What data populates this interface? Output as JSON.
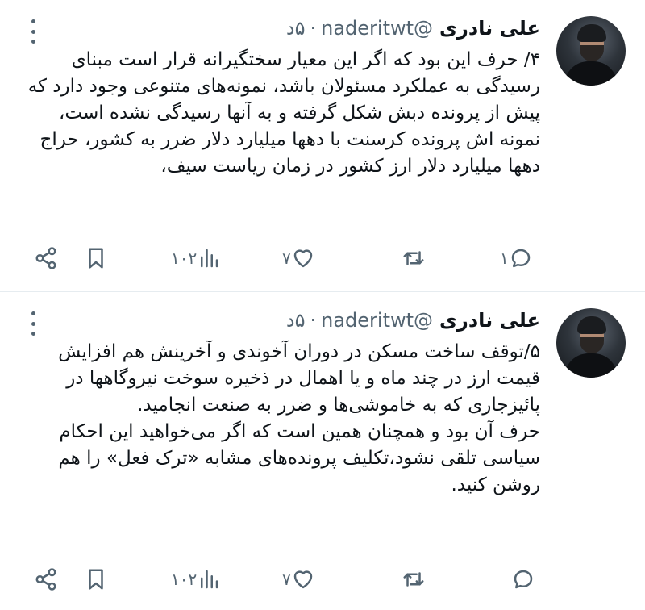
{
  "tweets": [
    {
      "name": "علی نادری",
      "handle": "@naderitwt",
      "separator": "·",
      "time": "۵د",
      "text": "۴/ حرف این بود که اگر این معیار سختگیرانه قرار است مبنای رسیدگی به عملکرد مسئولان باشد، نمونه‌های متنوعی وجود دارد که پیش از پرونده دبش شکل گرفته و به آنها رسیدگی نشده است، نمونه اش پرونده کرسنت با دهها میلیارد دلار ضرر به کشور، حراج دهها میلیارد دلار ارز کشور در زمان ریاست سیف،",
      "replies": "۱",
      "retweets": "",
      "likes": "۷",
      "views": "۱۰۲"
    },
    {
      "name": "علی نادری",
      "handle": "@naderitwt",
      "separator": "·",
      "time": "۵د",
      "text": "۵/توقف ساخت مسکن در دوران آخوندی و آخرینش هم افزایش قیمت ارز در چند ماه و یا اهمال در ذخیره سوخت نیروگاهها در پائیزجاری که به خاموشی‌ها و ضرر به صنعت انجامید.\nحرف آن بود و همچنان همین است که اگر می‌خواهید این احکام سیاسی تلقی نشود،تکلیف پرونده‌های مشابه «ترک فعل» را هم روشن کنید.",
      "replies": "",
      "retweets": "",
      "likes": "۷",
      "views": "۱۰۲"
    }
  ],
  "icons": {
    "reply": "reply-bubble-icon",
    "retweet": "retweet-arrows-icon",
    "like": "heart-icon",
    "views": "views-bar-chart-icon",
    "bookmark": "bookmark-icon",
    "share": "share-icon",
    "more": "more-vertical-dots-icon"
  },
  "colors": {
    "text": "#0f1419",
    "muted": "#536471",
    "divider": "#e6ecf0"
  }
}
